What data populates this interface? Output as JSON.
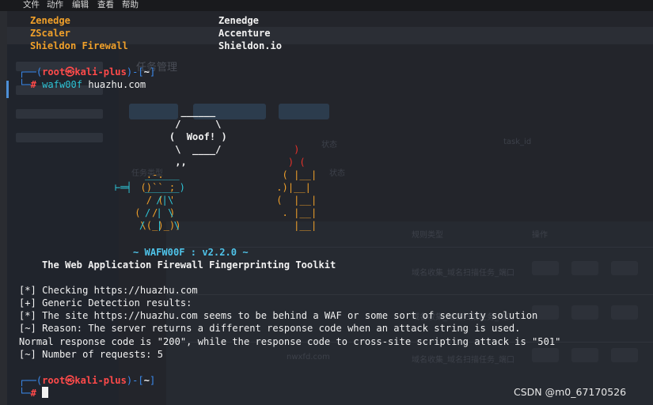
{
  "menu": [
    "文件",
    "动作",
    "编辑",
    "查看",
    "帮助"
  ],
  "waf_list": {
    "left": [
      "Zenedge",
      "ZScaler",
      "Shieldon Firewall"
    ],
    "right": [
      "Zenedge",
      "Accenture",
      "Shieldon.io"
    ]
  },
  "prompt": {
    "open": "┌──(",
    "user": "root㉿kali-plus",
    "mid": ")-[",
    "dir": "~",
    "close": "]",
    "hash_prefix": "└─",
    "hash": "#"
  },
  "command": {
    "program": "wafw00f",
    "arg": " huazhu.com"
  },
  "banner": {
    "version_line": "~ WAFW00F : v2.2.0 ~",
    "subtitle": "The Web Application Firewall Fingerprinting Toolkit"
  },
  "ascii_art": {
    "dog": [
      "                ______",
      "               /      \\",
      "              (  Woof! )",
      "               \\  ____/",
      "               ,,",
      "          .-. _",
      "         ()`` ;",
      "          / ( '",
      "        (  /  )",
      "         \\(_)_))"
    ],
    "dog_leash": "⊢═╡",
    "gun": [
      "______",
      "______)",
      " /|\\",
      "/ | \\",
      "/  |  \\"
    ],
    "fire": [
      "    )",
      "   ) (",
      "  ( |__|",
      " .)|__|",
      " (  |__|",
      "  . |__|",
      "    |__|"
    ]
  },
  "output": [
    "[*] Checking https://huazhu.com",
    "[+] Generic Detection results:",
    "[*] The site https://huazhu.com seems to be behind a WAF or some sort of security solution",
    "[~] Reason: The server returns a different response code when an attack string is used.",
    "Normal response code is \"200\", while the response code to cross-site scripting attack is \"501\"",
    "[~] Number of requests: 5"
  ],
  "background": {
    "title": "任务管理",
    "labels": [
      "状态",
      "task_id",
      "任务类型",
      "状态",
      "规则类型",
      "操作",
      "返回值"
    ],
    "rows": [
      "域名收集_域名扫描任务_端口",
      "域名收集_域名扫描任务_端口",
      "域名收集_域名扫描任务_端口"
    ],
    "row_domain": "nwxfd.com"
  },
  "watermark": "CSDN @m0_67170526"
}
